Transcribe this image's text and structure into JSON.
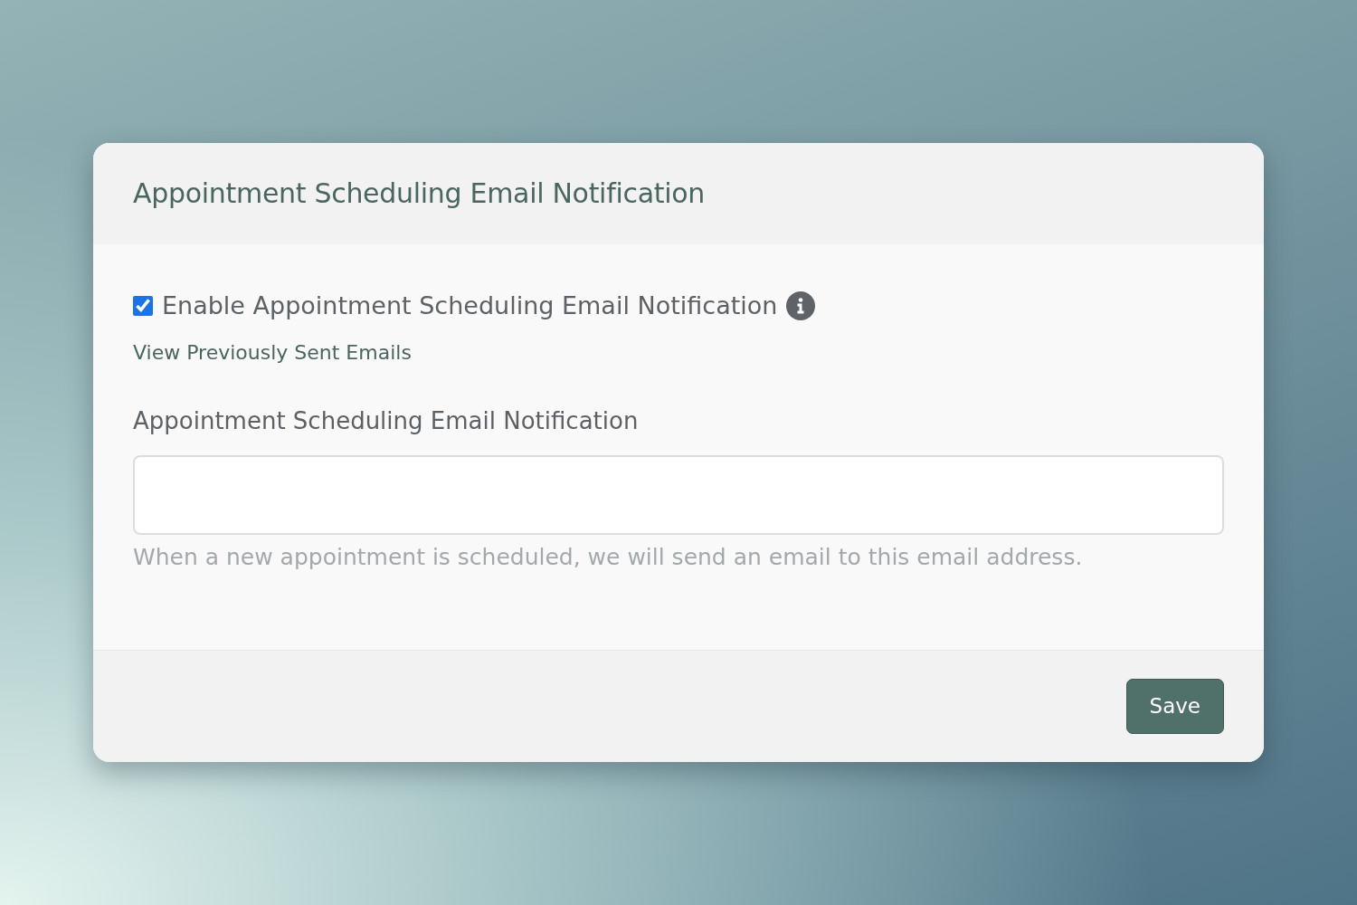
{
  "card": {
    "title": "Appointment Scheduling Email Notification"
  },
  "enable_checkbox": {
    "label": "Enable Appointment Scheduling Email Notification",
    "checked": true
  },
  "link": "View Previously Sent Emails",
  "email_field": {
    "label": "Appointment Scheduling Email Notification",
    "help": "When a new appointment is scheduled, we will send an email to this email address."
  },
  "buttons": [
    "Save"
  ]
}
